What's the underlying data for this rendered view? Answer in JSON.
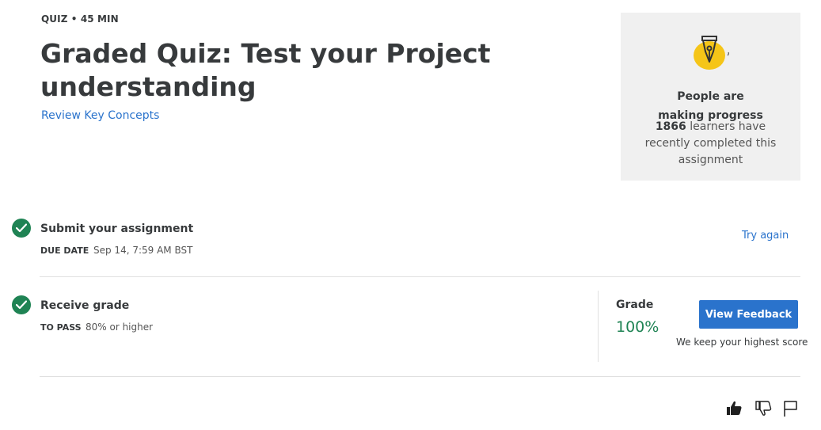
{
  "header": {
    "eyebrow": "QUIZ • 45 MIN",
    "title": "Graded Quiz: Test your Project understanding",
    "review_link": "Review Key Concepts"
  },
  "progress_card": {
    "heading": "People are making progress",
    "count": "1866",
    "body_rest": " learners have recently completed this assignment",
    "icon": "pen-nib-icon",
    "accent": "#f5c518"
  },
  "submit_step": {
    "title": "Submit your assignment",
    "due_label": "DUE DATE",
    "due_value": "Sep 14, 7:59 AM BST",
    "action": "Try again"
  },
  "grade_step": {
    "title": "Receive grade",
    "pass_label": "TO PASS",
    "pass_value": "80% or higher",
    "grade_label": "Grade",
    "grade_value": "100%",
    "button": "View Feedback",
    "note": "We keep your highest score"
  },
  "colors": {
    "primary": "#2a73cc",
    "success": "#1f8354",
    "card_bg": "#f0f0f0"
  },
  "feedback": {
    "icons": [
      "thumbs-up-icon",
      "thumbs-down-icon",
      "flag-icon"
    ]
  }
}
